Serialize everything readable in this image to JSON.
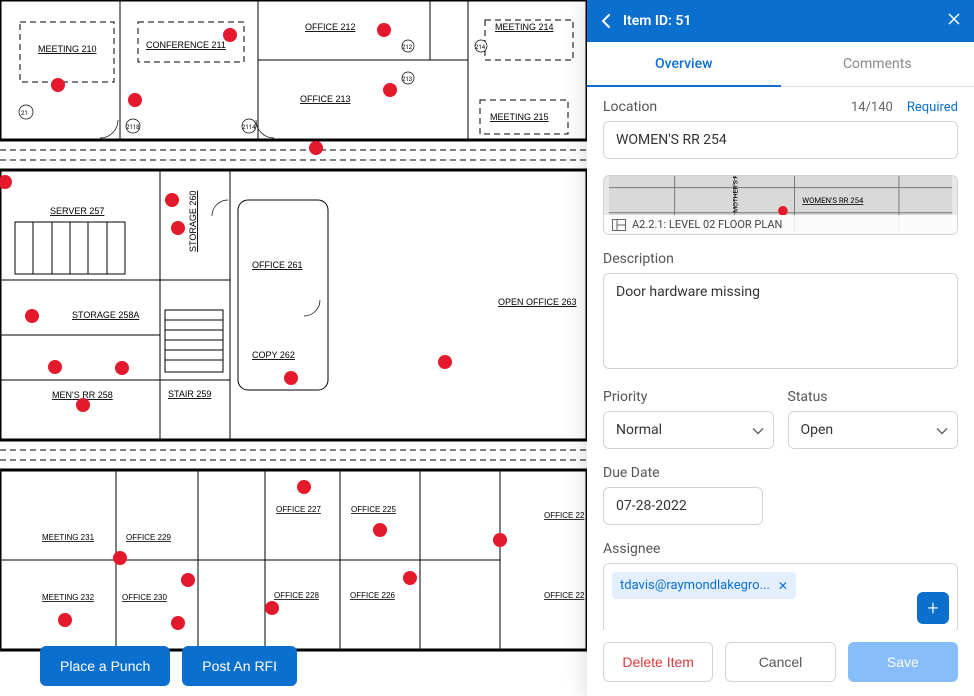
{
  "floorplan": {
    "rooms": [
      "MEETING  210",
      "CONFERENCE  211",
      "OFFICE  212",
      "OFFICE  213",
      "MEETING  214",
      "MEETING  215",
      "SERVER  257",
      "STORAGE  260",
      "STORAGE  258A",
      "OFFICE  261",
      "COPY  262",
      "OPEN OFFICE  263",
      "MEN'S  RR   258",
      "STAIR  259",
      "MEETING  231",
      "OFFICE  229",
      "OFFICE  227",
      "OFFICE  225",
      "OFFICE  22",
      "MEETING  232",
      "OFFICE  230",
      "OFFICE  228",
      "OFFICE  226",
      "OFFICE  22"
    ],
    "actions": {
      "place_punch": "Place a Punch",
      "post_rfi": "Post An RFI"
    }
  },
  "panel": {
    "header_title": "Item ID: 51",
    "tabs": {
      "overview": "Overview",
      "comments": "Comments"
    },
    "location": {
      "label": "Location",
      "char_count": "14/140",
      "required": "Required",
      "value": "WOMEN'S RR 254"
    },
    "snippet": {
      "caption": "A2.2.1: LEVEL 02 FLOOR PLAN",
      "labels": {
        "womens_rr": "WOMEN'S RR   254",
        "mothers": "MOTHER'S R"
      }
    },
    "description": {
      "label": "Description",
      "value": "Door hardware missing"
    },
    "priority": {
      "label": "Priority",
      "value": "Normal"
    },
    "status": {
      "label": "Status",
      "value": "Open"
    },
    "due_date": {
      "label": "Due Date",
      "value": "07-28-2022"
    },
    "assignee": {
      "label": "Assignee",
      "chip": "tdavis@raymondlakegro..."
    },
    "footer": {
      "delete": "Delete Item",
      "cancel": "Cancel",
      "save": "Save"
    }
  }
}
